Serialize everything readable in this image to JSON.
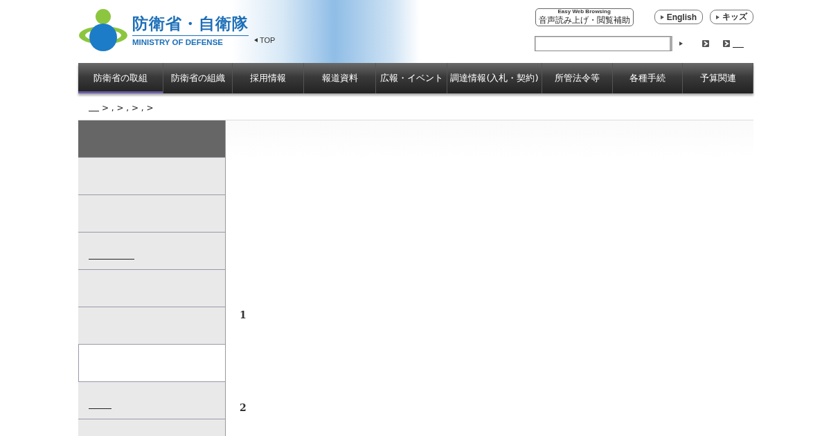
{
  "header": {
    "logo_title": "防衛省・自衛隊",
    "logo_subtitle": "MINISTRY OF DEFENSE",
    "top_link": "TOP",
    "accessibility_button": {
      "caption": "Easy Web Browsing",
      "label": "音声読み上げ・閲覧補助"
    },
    "language_buttons": [
      "English",
      "キッズ"
    ]
  },
  "nav": [
    {
      "label": "防衛省の取組",
      "selected": true
    },
    {
      "label": "防衛省の組織",
      "selected": false
    },
    {
      "label": "採用情報",
      "selected": false
    },
    {
      "label": "報道資料",
      "selected": false
    },
    {
      "label": "広報・イベント",
      "selected": false
    },
    {
      "label": "調達情報(入札・契約)",
      "selected": false
    },
    {
      "label": "所管法令等",
      "selected": false
    },
    {
      "label": "各種手続",
      "selected": false
    },
    {
      "label": "予算関連",
      "selected": false
    }
  ],
  "breadcrumb": "> , > , > , >",
  "sidebar": [
    {
      "kind": "header",
      "selected": false
    },
    {
      "kind": "item",
      "selected": false
    },
    {
      "kind": "item",
      "selected": false
    },
    {
      "kind": "item",
      "selected": false,
      "link": true
    },
    {
      "kind": "item",
      "selected": false
    },
    {
      "kind": "item",
      "selected": false
    },
    {
      "kind": "item",
      "selected": true
    },
    {
      "kind": "item",
      "selected": false,
      "link": true
    },
    {
      "kind": "item",
      "selected": false
    }
  ],
  "content": {
    "numbers": [
      "1",
      "2"
    ]
  }
}
